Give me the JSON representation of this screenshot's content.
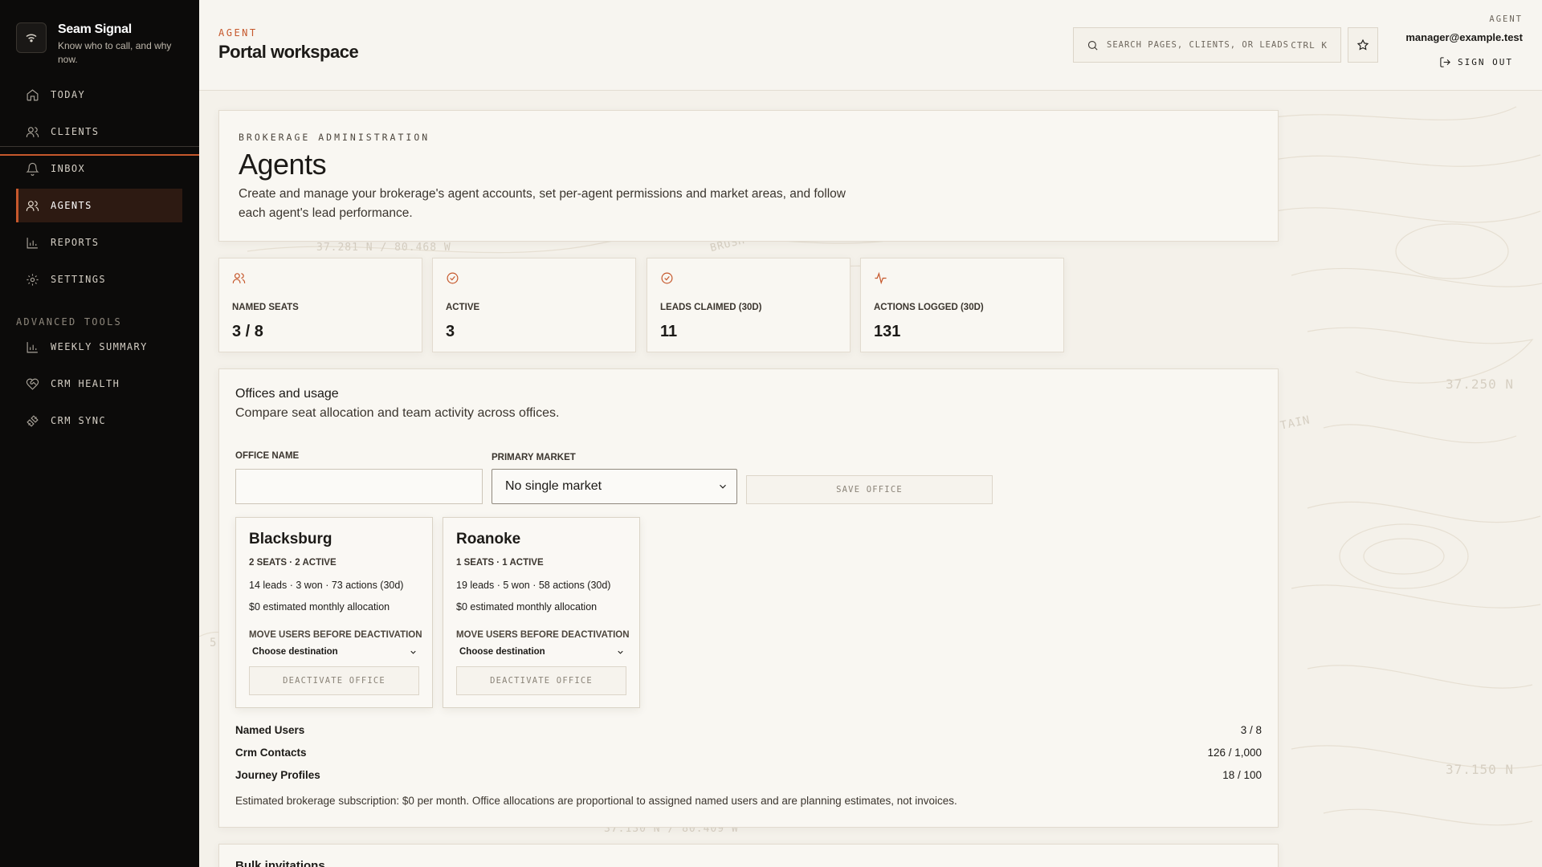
{
  "brand": {
    "name": "Seam Signal",
    "tagline": "Know who to call, and why now."
  },
  "nav": [
    {
      "label": "TODAY",
      "icon": "home-icon",
      "active": false
    },
    {
      "label": "CLIENTS",
      "icon": "users-icon",
      "active": false
    },
    {
      "label": "INBOX",
      "icon": "bell-icon",
      "active": false
    },
    {
      "label": "AGENTS",
      "icon": "users-icon",
      "active": true
    },
    {
      "label": "REPORTS",
      "icon": "bar-chart-icon",
      "active": false
    },
    {
      "label": "SETTINGS",
      "icon": "gear-icon",
      "active": false
    }
  ],
  "advanced": {
    "title": "ADVANCED TOOLS",
    "items": [
      {
        "label": "WEEKLY SUMMARY",
        "icon": "bar-chart-icon"
      },
      {
        "label": "CRM HEALTH",
        "icon": "heart-handshake-icon"
      },
      {
        "label": "CRM SYNC",
        "icon": "plug-icon"
      }
    ]
  },
  "topbar": {
    "crumb": "AGENT",
    "title": "Portal workspace",
    "search_placeholder": "SEARCH PAGES, CLIENTS, OR LEADS",
    "search_shortcut": "CTRL K",
    "role": "AGENT",
    "email": "manager@example.test",
    "signout": "SIGN OUT"
  },
  "hero": {
    "eyebrow": "BROKERAGE ADMINISTRATION",
    "title": "Agents",
    "description": "Create and manage your brokerage's agent accounts, set per-agent permissions and market areas, and follow each agent's lead performance."
  },
  "stats": [
    {
      "label": "NAMED SEATS",
      "value": "3 / 8",
      "icon": "users-icon"
    },
    {
      "label": "ACTIVE",
      "value": "3",
      "icon": "check-circle-icon"
    },
    {
      "label": "LEADS CLAIMED (30D)",
      "value": "11",
      "icon": "check-circle-icon"
    },
    {
      "label": "ACTIONS LOGGED (30D)",
      "value": "131",
      "icon": "activity-icon"
    }
  ],
  "offices": {
    "title": "Offices and usage",
    "subtitle": "Compare seat allocation and team activity across offices.",
    "office_name_label": "OFFICE NAME",
    "office_name_value": "",
    "primary_market_label": "PRIMARY MARKET",
    "primary_market_value": "No single market",
    "save_label": "SAVE OFFICE",
    "list": [
      {
        "name": "Blacksburg",
        "seats": "2 SEATS · 2 ACTIVE",
        "stats": "14 leads · 3 won · 73 actions (30d)",
        "allocation": "$0 estimated monthly allocation",
        "move_label": "MOVE USERS BEFORE DEACTIVATION",
        "destination": "Choose destination",
        "button": "DEACTIVATE OFFICE"
      },
      {
        "name": "Roanoke",
        "seats": "1 SEATS · 1 ACTIVE",
        "stats": "19 leads · 5 won · 58 actions (30d)",
        "allocation": "$0 estimated monthly allocation",
        "move_label": "MOVE USERS BEFORE DEACTIVATION",
        "destination": "Choose destination",
        "button": "DEACTIVATE OFFICE"
      }
    ],
    "usage": [
      {
        "label": "Named Users",
        "value": "3 / 8"
      },
      {
        "label": "Crm Contacts",
        "value": "126 / 1,000"
      },
      {
        "label": "Journey Profiles",
        "value": "18 / 100"
      }
    ],
    "note": "Estimated brokerage subscription: $0 per month. Office allocations are proportional to assigned named users and are planning estimates, not invoices."
  },
  "map_labels": {
    "c1": "37.281 N / 80.468 W",
    "c2": "BRUSH",
    "c3": "37.250 N",
    "c4": "TAIN",
    "c5": "37.150 N",
    "c6": "37.130 N / 80.409 W",
    "c7": "5"
  },
  "bulk": {
    "title": "Bulk invitations"
  },
  "colors": {
    "accent": "#c6582c",
    "sidebar": "#0c0b0a",
    "background": "#f4f1ea"
  }
}
